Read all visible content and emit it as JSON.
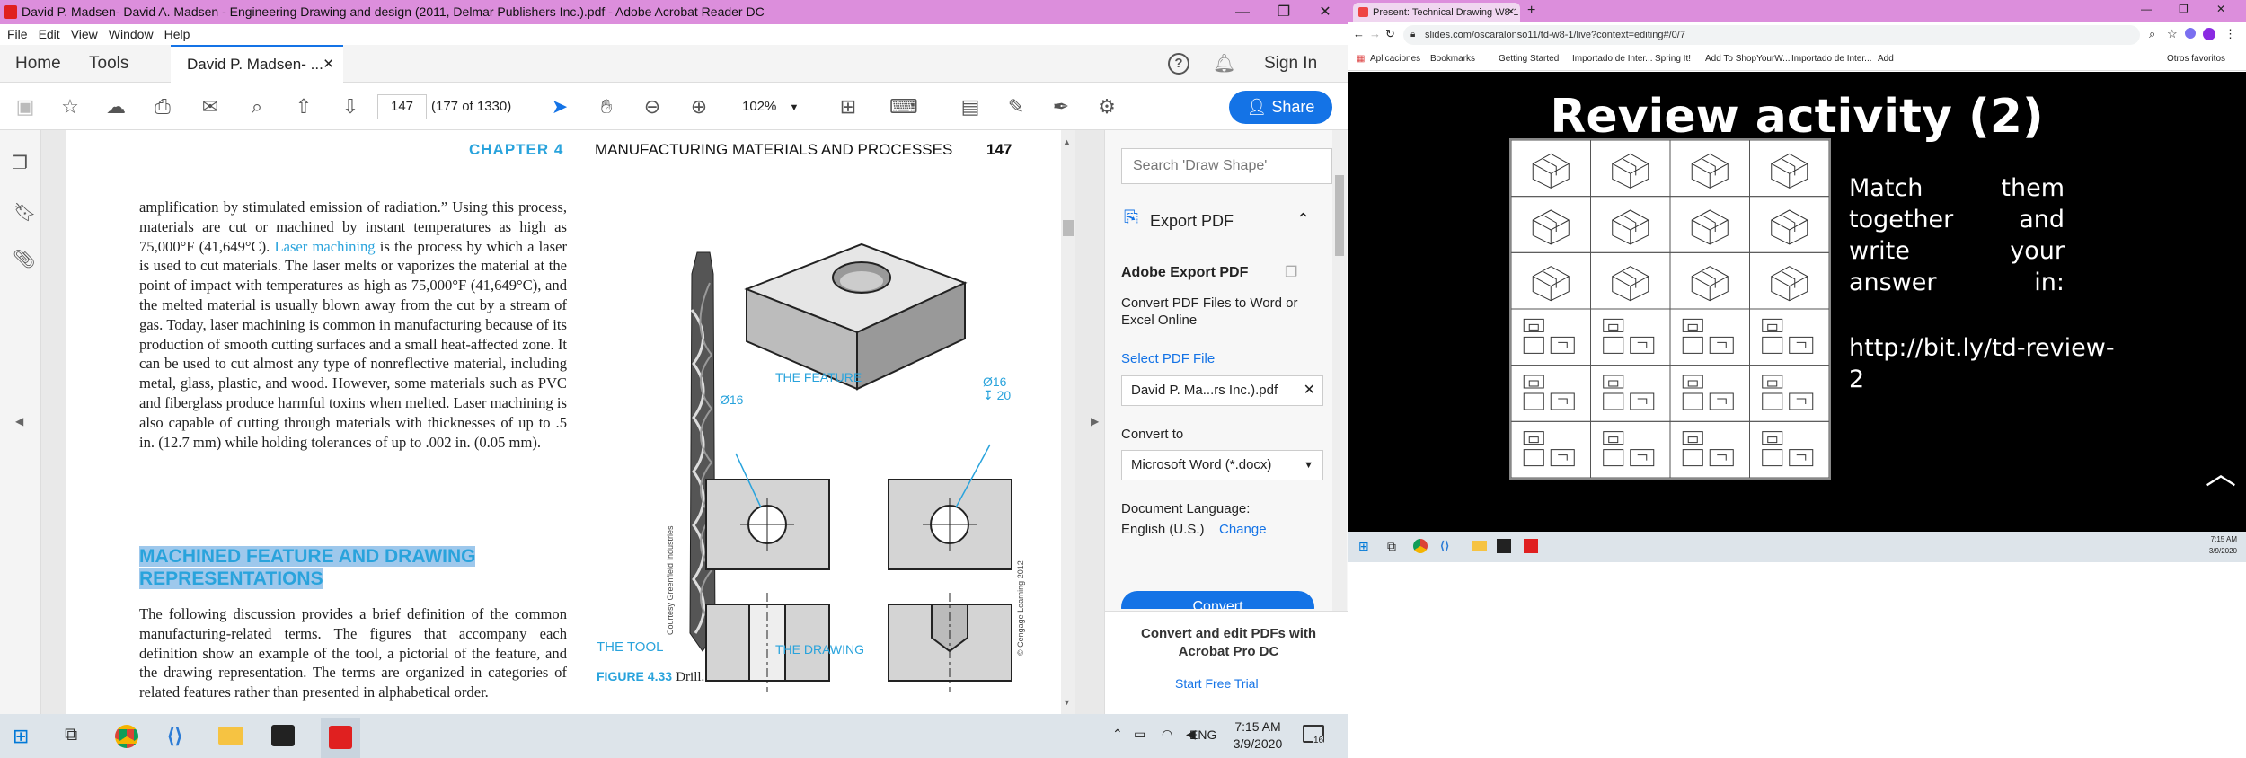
{
  "acrobat": {
    "title": "David P. Madsen- David A. Madsen - Engineering Drawing and design (2011, Delmar Publishers Inc.).pdf - Adobe Acrobat Reader DC",
    "menu": [
      "File",
      "Edit",
      "View",
      "Window",
      "Help"
    ],
    "nav": {
      "home": "Home",
      "tools": "Tools",
      "doc_tab": "David P. Madsen- ...",
      "sign_in": "Sign In"
    },
    "toolbar": {
      "page_value": "147",
      "page_count": "(177 of 1330)",
      "zoom": "102%",
      "share": "Share"
    },
    "page": {
      "chapter": "CHAPTER 4",
      "running_head": "MANUFACTURING MATERIALS AND PROCESSES",
      "page_number": "147",
      "para1_before": "amplification by stimulated emission of radiation.” Using this process, materials are cut or machined by instant temperatures as high as 75,000°F (41,649°C). ",
      "para1_link": "Laser machining",
      "para1_after": " is the process by which a laser is used to cut materials. The laser melts or vaporizes the material at the point of impact with temperatures as high as 75,000°F (41,649°C), and the melted material is usually blown away from the cut by a stream of gas. Today, laser machining is common in manufacturing because of its production of smooth cutting surfaces and a small heat-affected zone. It can be used to cut almost any type of nonreflective material, including metal, glass, plastic, and wood. However, some materials such as PVC and fiberglass produce harmful toxins when melted. Laser machining is also capable of cutting through materials with thicknesses of up to .5 in. (12.7 mm) while holding tolerances of up to .002 in. (0.05 mm).",
      "heading": "MACHINED FEATURE AND DRAWING REPRESENTATIONS",
      "para2": "The following discussion provides a brief definition of the common manufacturing-related terms. The figures that accompany each definition show an example of the tool, a pictorial of the feature, and the drawing representation. The terms are organized in categories of related features rather than presented in alphabetical order.",
      "label_feature": "THE FEATURE",
      "label_tool": "THE TOOL",
      "label_drawing": "THE DRAWING",
      "dim1": "Ø16",
      "dim2": "Ø16",
      "dim3": "↧ 20",
      "credit1": "Courtesy Greenfield Industries",
      "credit2": "© Cengage Learning 2012",
      "fig_num": "FIGURE 4.33",
      "fig_caption": "Drill."
    },
    "panel": {
      "search_placeholder": "Search 'Draw Shape'",
      "export_title": "Export PDF",
      "adobe_export": "Adobe Export PDF",
      "desc": "Convert PDF Files to Word or Excel Online",
      "select_pdf": "Select PDF File",
      "file": "David P. Ma...rs Inc.).pdf",
      "convert_to": "Convert to",
      "format": "Microsoft Word (*.docx)",
      "doc_lang": "Document Language:",
      "lang": "English (U.S.)",
      "change": "Change",
      "convert_btn": "Convert",
      "promo": "Convert and edit PDFs with Acrobat Pro DC",
      "trial": "Start Free Trial"
    },
    "taskbar": {
      "time": "7:15 AM",
      "date": "3/9/2020",
      "lang": "ENG",
      "badge": "16"
    }
  },
  "chrome": {
    "tab_title": "Present: Technical Drawing W8-1",
    "url": "slides.com/oscaralonso11/td-w8-1/live?context=editing#/0/7",
    "bookmarks": [
      "Aplicaciones",
      "Bookmarks",
      "Getting Started",
      "Importado de Inter...",
      "Spring It!",
      "Add To ShopYourW...",
      "Importado de Inter...",
      "Add"
    ],
    "other_bookmarks": "Otros favoritos",
    "slide_title": "Review activity (2)",
    "slide_text": "Match them together and write your answer in:",
    "slide_url": "http://bit.ly/td-review-2",
    "time": "7:15 AM",
    "date": "3/9/2020"
  }
}
